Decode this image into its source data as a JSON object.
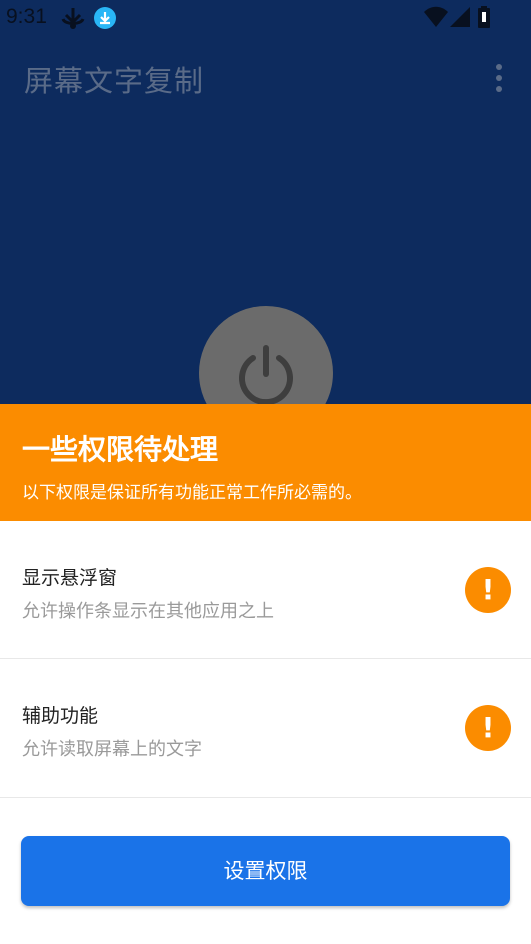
{
  "status_bar": {
    "time": "9:31",
    "icons": [
      "usb-debug-icon",
      "download-icon",
      "wifi-icon",
      "signal-icon",
      "battery-icon"
    ],
    "download_badge_color": "#29b6f6"
  },
  "app_bar": {
    "title": "屏幕文字复制",
    "menu_icon": "more-vert-icon"
  },
  "main": {
    "power_icon": "power-icon"
  },
  "sheet": {
    "title": "一些权限待处理",
    "subtitle": "以下权限是保证所有功能正常工作所必需的。",
    "header_color": "#fb8c00",
    "permissions": [
      {
        "title": "显示悬浮窗",
        "description": "允许操作条显示在其他应用之上",
        "status_icon": "warning-icon"
      },
      {
        "title": "辅助功能",
        "description": "允许读取屏幕上的文字",
        "status_icon": "warning-icon"
      }
    ],
    "warning_glyph": "!",
    "button_label": "设置权限",
    "button_color": "#1a73e8"
  }
}
